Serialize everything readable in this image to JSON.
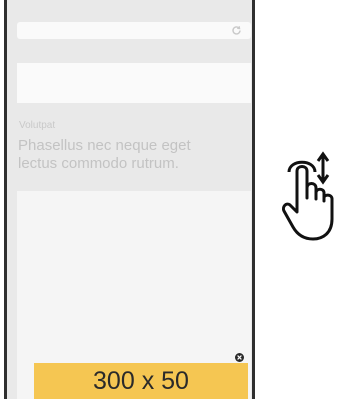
{
  "article": {
    "small_label": "Volutpat",
    "headline_line1": "Phasellus nec neque eget",
    "headline_line2": "lectus commodo rutrum."
  },
  "ad": {
    "size_label": "300 x 50"
  },
  "icons": {
    "reload": "reload-icon",
    "close": "close-ad-icon",
    "gesture": "vertical-scroll-gesture-icon"
  },
  "colors": {
    "ad_background": "#f5c652",
    "device_frame": "#2f2f2f",
    "page_gray": "#e9e9e9"
  }
}
